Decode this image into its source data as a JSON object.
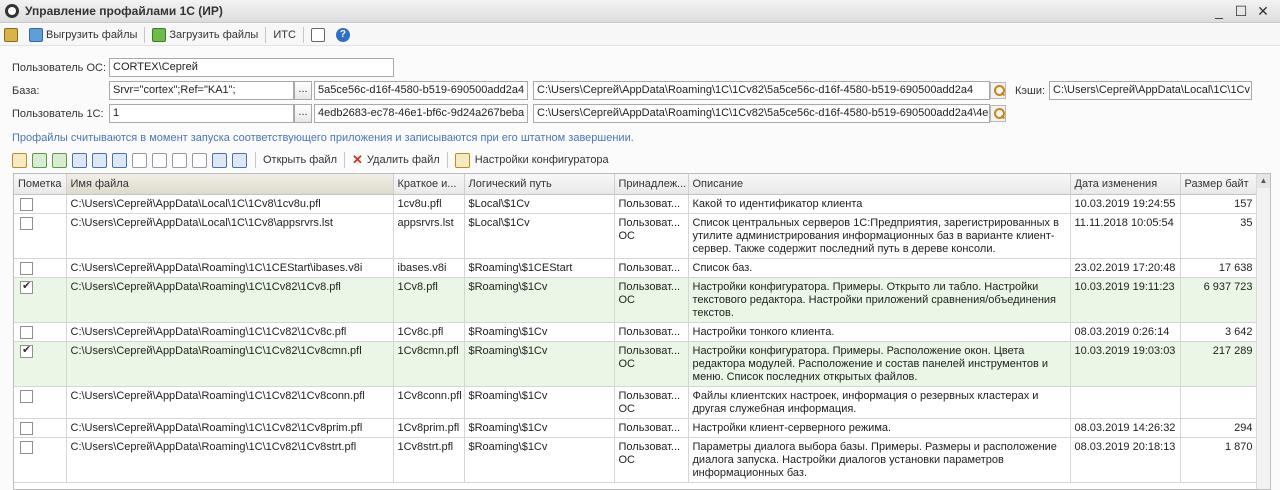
{
  "window": {
    "title": "Управление профайлами 1С (ИР)"
  },
  "toolbar": {
    "export_label": "Выгрузить файлы",
    "import_label": "Загрузить файлы",
    "its_label": "ИТС"
  },
  "form": {
    "os_user_label": "Пользователь ОС:",
    "os_user_value": "CORTEX\\Сергей",
    "base_label": "База:",
    "base_conn": "Srvr=\"cortex\";Ref=\"KA1\";",
    "base_guid": "5a5ce56c-d16f-4580-b519-690500add2a4",
    "base_path": "C:\\Users\\Сергей\\AppData\\Roaming\\1C\\1Cv82\\5a5ce56c-d16f-4580-b519-690500add2a4",
    "cache_label": "Кэши:",
    "cache_path": "C:\\Users\\Сергей\\AppData\\Local\\1C\\1Cv",
    "user1c_label": "Пользователь 1С:",
    "user1c_value": "1",
    "user_guid": "4edb2683-ec78-46e1-bf6c-9d24a267beba",
    "user_path": "C:\\Users\\Сергей\\AppData\\Roaming\\1C\\1Cv82\\5a5ce56c-d16f-4580-b519-690500add2a4\\4e"
  },
  "info_text": "Профайлы считываются в момент запуска соответствующего приложения и записываются при его штатном завершении.",
  "table_toolbar": {
    "open_label": "Открыть файл",
    "delete_label": "Удалить файл",
    "settings_label": "Настройки конфигуратора"
  },
  "table": {
    "columns": [
      "Пометка",
      "Имя файла",
      "Краткое и...",
      "Логический путь",
      "Принадлеж...",
      "Описание",
      "Дата изменения",
      "Размер байт"
    ],
    "rows": [
      {
        "checked": false,
        "hl": false,
        "file": "C:\\Users\\Сергей\\AppData\\Local\\1C\\1Cv8\\1cv8u.pfl",
        "short": "1cv8u.pfl",
        "logical": "$Local\\$1Cv",
        "owner": "Пользоват...",
        "desc": "Какой то идентификатор клиента",
        "date": "10.03.2019 19:24:55",
        "size": "157"
      },
      {
        "checked": false,
        "hl": false,
        "file": "C:\\Users\\Сергей\\AppData\\Local\\1C\\1Cv8\\appsrvrs.lst",
        "short": "appsrvrs.lst",
        "logical": "$Local\\$1Cv",
        "owner": "Пользоват... ОС",
        "desc": "Список центральных серверов 1С:Предприятия, зарегистрированных в утилите администрирования информационных баз в варианте клиент-сервер. Также содержит последний путь в дереве консоли.",
        "date": "11.11.2018 10:05:54",
        "size": "35"
      },
      {
        "checked": false,
        "hl": false,
        "file": "C:\\Users\\Сергей\\AppData\\Roaming\\1C\\1CEStart\\ibases.v8i",
        "short": "ibases.v8i",
        "logical": "$Roaming\\$1CEStart",
        "owner": "Пользоват...",
        "desc": "Список баз.",
        "date": "23.02.2019 17:20:48",
        "size": "17 638"
      },
      {
        "checked": true,
        "hl": true,
        "file": "C:\\Users\\Сергей\\AppData\\Roaming\\1C\\1Cv82\\1Cv8.pfl",
        "short": "1Cv8.pfl",
        "logical": "$Roaming\\$1Cv",
        "owner": "Пользоват... ОС",
        "desc": "Настройки конфигуратора. Примеры. Открыто ли табло. Настройки текстового редактора. Настройки приложений сравнения/объединения текстов.",
        "date": "10.03.2019 19:11:23",
        "size": "6 937 723"
      },
      {
        "checked": false,
        "hl": false,
        "file": "C:\\Users\\Сергей\\AppData\\Roaming\\1C\\1Cv82\\1Cv8c.pfl",
        "short": "1Cv8c.pfl",
        "logical": "$Roaming\\$1Cv",
        "owner": "Пользоват...",
        "desc": "Настройки тонкого клиента.",
        "date": "08.03.2019 0:26:14",
        "size": "3 642"
      },
      {
        "checked": true,
        "hl": true,
        "file": "C:\\Users\\Сергей\\AppData\\Roaming\\1C\\1Cv82\\1Cv8cmn.pfl",
        "short": "1Cv8cmn.pfl",
        "logical": "$Roaming\\$1Cv",
        "owner": "Пользоват... ОС",
        "desc": "Настройки конфигуратора. Примеры. Расположение окон. Цвета редактора модулей. Расположение и состав панелей инструментов и меню. Список последних открытых файлов.",
        "date": "10.03.2019 19:03:03",
        "size": "217 289"
      },
      {
        "checked": false,
        "hl": false,
        "file": "C:\\Users\\Сергей\\AppData\\Roaming\\1C\\1Cv82\\1Cv8conn.pfl",
        "short": "1Cv8conn.pfl",
        "logical": "$Roaming\\$1Cv",
        "owner": "Пользоват... ОС",
        "desc": "Файлы клиентских настроек, информация о резервных кластерах и другая служебная информация.",
        "date": "",
        "size": ""
      },
      {
        "checked": false,
        "hl": false,
        "file": "C:\\Users\\Сергей\\AppData\\Roaming\\1C\\1Cv82\\1Cv8prim.pfl",
        "short": "1Cv8prim.pfl",
        "logical": "$Roaming\\$1Cv",
        "owner": "Пользоват...",
        "desc": "Настройки клиент-серверного режима.",
        "date": "08.03.2019 14:26:32",
        "size": "294"
      },
      {
        "checked": false,
        "hl": false,
        "file": "C:\\Users\\Сергей\\AppData\\Roaming\\1C\\1Cv82\\1Cv8strt.pfl",
        "short": "1Cv8strt.pfl",
        "logical": "$Roaming\\$1Cv",
        "owner": "Пользоват... ОС",
        "desc": "Параметры диалога выбора базы. Примеры. Размеры и расположение диалога запуска. Настройки диалогов установки параметров информационных баз.",
        "date": "08.03.2019 20:18:13",
        "size": "1 870"
      }
    ]
  }
}
